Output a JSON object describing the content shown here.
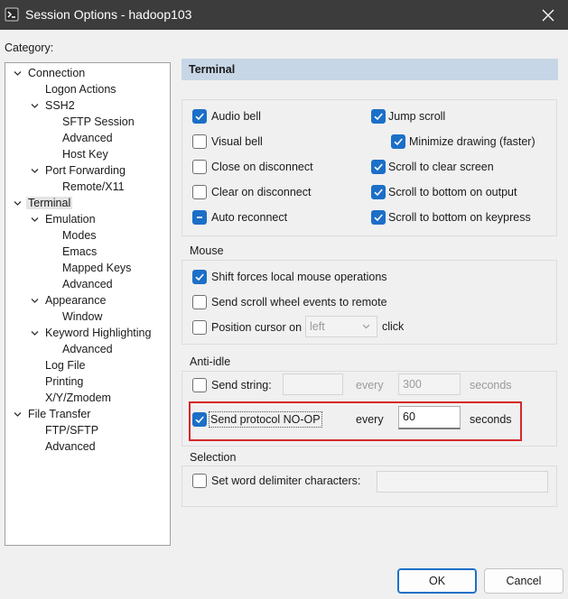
{
  "window": {
    "title": "Session Options - hadoop103"
  },
  "category_label": "Category:",
  "tree": {
    "connection": "Connection",
    "logon_actions": "Logon Actions",
    "ssh2": "SSH2",
    "sftp_session": "SFTP Session",
    "ssh2_advanced": "Advanced",
    "host_key": "Host Key",
    "port_forwarding": "Port Forwarding",
    "remote_x11": "Remote/X11",
    "terminal": "Terminal",
    "emulation": "Emulation",
    "modes": "Modes",
    "emacs": "Emacs",
    "mapped_keys": "Mapped Keys",
    "emulation_advanced": "Advanced",
    "appearance": "Appearance",
    "window": "Window",
    "keyword_highlighting": "Keyword Highlighting",
    "keyword_advanced": "Advanced",
    "log_file": "Log File",
    "printing": "Printing",
    "xyzmodem": "X/Y/Zmodem",
    "file_transfer": "File Transfer",
    "ftp_sftp": "FTP/SFTP",
    "ft_advanced": "Advanced"
  },
  "panel": {
    "header": "Terminal"
  },
  "terminal_options": {
    "audio_bell": "Audio bell",
    "visual_bell": "Visual bell",
    "close_on_disconnect": "Close on disconnect",
    "clear_on_disconnect": "Clear on disconnect",
    "auto_reconnect": "Auto reconnect",
    "jump_scroll": "Jump scroll",
    "minimize_drawing": "Minimize drawing (faster)",
    "scroll_to_clear": "Scroll to clear screen",
    "scroll_bottom_output": "Scroll to bottom on output",
    "scroll_bottom_keypress": "Scroll to bottom on keypress"
  },
  "mouse": {
    "title": "Mouse",
    "shift_forces": "Shift forces local mouse operations",
    "send_scroll_wheel": "Send scroll wheel events to remote",
    "position_cursor": "Position cursor on",
    "position_value": "left",
    "click": "click"
  },
  "anti_idle": {
    "title": "Anti-idle",
    "send_string": "Send string:",
    "send_string_value": "",
    "every": "every",
    "string_interval": "300",
    "seconds": "seconds",
    "send_noop": "Send protocol NO-OP",
    "noop_every": "every",
    "noop_interval": "60",
    "noop_seconds": "seconds"
  },
  "selection": {
    "title": "Selection",
    "word_delim": "Set word delimiter characters:",
    "word_delim_value": ""
  },
  "buttons": {
    "ok": "OK",
    "cancel": "Cancel"
  }
}
